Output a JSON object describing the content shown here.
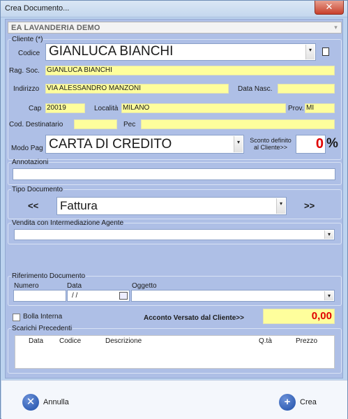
{
  "window": {
    "title": "Crea Documento...",
    "close_glyph": "✕"
  },
  "company_combo": {
    "value": "EA LAVANDERIA DEMO",
    "arrow_glyph": "▾"
  },
  "cliente": {
    "legend": "Cliente (*)",
    "codice_label": "Codice",
    "codice_value": "GIANLUCA BIANCHI",
    "new_doc_icon": "document-icon",
    "rag_soc_label": "Rag. Soc.",
    "rag_soc_value": "GIANLUCA BIANCHI",
    "indirizzo_label": "Indirizzo",
    "indirizzo_value": "VIA ALESSANDRO MANZONI",
    "data_nasc_label": "Data Nasc.",
    "data_nasc_value": "",
    "cap_label": "Cap",
    "cap_value": "20019",
    "localita_label": "Località",
    "localita_value": "MILANO",
    "prov_label": "Prov.",
    "prov_value": "MI",
    "cod_dest_label": "Cod. Destinatario",
    "cod_dest_value": "",
    "pec_label": "Pec",
    "pec_value": "",
    "modo_pag_label": "Modo Pag",
    "modo_pag_value": "CARTA DI CREDITO",
    "sconto_label_1": "Sconto definito",
    "sconto_label_2": "al Cliente>>",
    "sconto_value": "0",
    "sconto_unit": "%"
  },
  "annotazioni": {
    "legend": "Annotazioni",
    "value": ""
  },
  "tipo_documento": {
    "legend": "Tipo Documento",
    "prev_label": "<<",
    "next_label": ">>",
    "value": "Fattura"
  },
  "vendita": {
    "legend": "Vendita con Intermediazione Agente",
    "value": ""
  },
  "riferimento": {
    "legend": "Riferimento Documento",
    "numero_label": "Numero",
    "data_label": "Data",
    "oggetto_label": "Oggetto",
    "numero_value": "",
    "data_value": " /  /",
    "oggetto_value": ""
  },
  "bolla_interna": {
    "label": "Bolla Interna",
    "checked": false
  },
  "acconto": {
    "label": "Acconto Versato dal  Cliente>>",
    "value": "0,00"
  },
  "scarichi": {
    "legend": "Scarichi Precedenti",
    "columns": [
      "Data",
      "Codice",
      "Descrizione",
      "Q.tà",
      "Prezzo"
    ]
  },
  "buttons": {
    "annulla_label": "Annulla",
    "annulla_icon": "x-circle-icon",
    "annulla_glyph": "✕",
    "crea_label": "Crea",
    "crea_icon": "plus-circle-icon",
    "crea_glyph": "+"
  },
  "colors": {
    "field_yellow": "#fefe9c",
    "panel_blue": "#aebfe6",
    "discount_red": "#e00000",
    "button_blue": "#1f4fa8"
  }
}
